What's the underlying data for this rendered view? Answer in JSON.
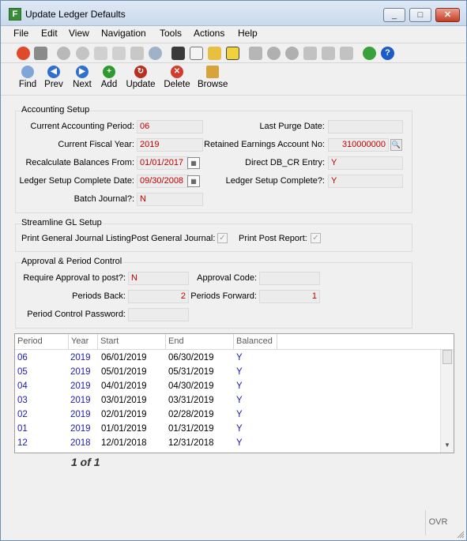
{
  "window": {
    "title": "Update Ledger Defaults",
    "controls": {
      "minimize": "_",
      "maximize": "□",
      "close": "✕"
    }
  },
  "menu": [
    "File",
    "Edit",
    "View",
    "Navigation",
    "Tools",
    "Actions",
    "Help"
  ],
  "nav": {
    "find": "Find",
    "prev": "Prev",
    "next": "Next",
    "add": "Add",
    "update": "Update",
    "delete": "Delete",
    "browse": "Browse"
  },
  "accounting": {
    "title": "Accounting Setup",
    "current_period_label": "Current Accounting Period:",
    "current_period": "06",
    "last_purge_label": "Last Purge Date:",
    "last_purge": "",
    "fiscal_year_label": "Current Fiscal Year:",
    "fiscal_year": "2019",
    "retained_label": "Retained Earnings Account No:",
    "retained": "310000000",
    "recalc_label": "Recalculate Balances From:",
    "recalc": "01/01/2017",
    "direct_label": "Direct DB_CR Entry:",
    "direct": "Y",
    "setup_date_label": "Ledger Setup Complete Date:",
    "setup_date": "09/30/2008",
    "setup_complete_label": "Ledger Setup Complete?:",
    "setup_complete": "Y",
    "batch_label": "Batch Journal?:",
    "batch": "N"
  },
  "streamline": {
    "title": "Streamline GL Setup",
    "print_general_label": "Print General Journal Listing:",
    "post_general_label": "Post General Journal:",
    "print_post_label": "Print Post Report:"
  },
  "approval": {
    "title": "Approval & Period Control",
    "require_label": "Require Approval to post?:",
    "require": "N",
    "code_label": "Approval Code:",
    "code": "",
    "back_label": "Periods Back:",
    "back": "2",
    "forward_label": "Periods Forward:",
    "forward": "1",
    "password_label": "Period Control Password:",
    "password": ""
  },
  "table": {
    "columns": [
      "Period",
      "Year",
      "Start",
      "End",
      "Balanced"
    ],
    "rows": [
      [
        "06",
        "2019",
        "06/01/2019",
        "06/30/2019",
        "Y"
      ],
      [
        "05",
        "2019",
        "05/01/2019",
        "05/31/2019",
        "Y"
      ],
      [
        "04",
        "2019",
        "04/01/2019",
        "04/30/2019",
        "Y"
      ],
      [
        "03",
        "2019",
        "03/01/2019",
        "03/31/2019",
        "Y"
      ],
      [
        "02",
        "2019",
        "02/01/2019",
        "02/28/2019",
        "Y"
      ],
      [
        "01",
        "2019",
        "01/01/2019",
        "01/31/2019",
        "Y"
      ],
      [
        "12",
        "2018",
        "12/01/2018",
        "12/31/2018",
        "Y"
      ]
    ]
  },
  "pager": "1 of 1",
  "status": {
    "ovr": "OVR"
  }
}
